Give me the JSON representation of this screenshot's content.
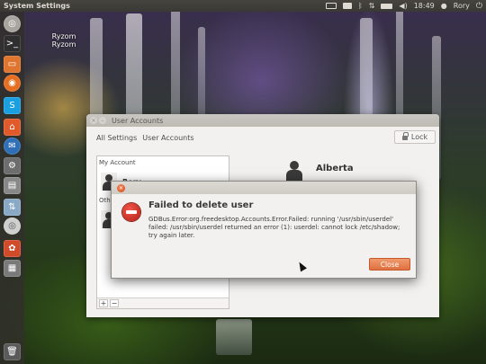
{
  "top_panel": {
    "app_title": "System Settings",
    "clock": "18:49",
    "user_name": "Rory"
  },
  "launcher": {
    "items": [
      {
        "name": "dash-icon",
        "color": "#a8a5a0"
      },
      {
        "name": "terminal-icon",
        "color": "#2f2f2f"
      },
      {
        "name": "files-icon",
        "color": "#e0752f"
      },
      {
        "name": "firefox-icon",
        "color": "#e66e21"
      },
      {
        "name": "skype-icon",
        "color": "#1a9fe0"
      },
      {
        "name": "software-center-icon",
        "color": "#e05a2b"
      },
      {
        "name": "thunderbird-icon",
        "color": "#2f6fb8"
      },
      {
        "name": "settings-icon",
        "color": "#6d6d6d"
      },
      {
        "name": "drive-icon",
        "color": "#888888"
      },
      {
        "name": "network-icon",
        "color": "#8aa9c6"
      },
      {
        "name": "dvd-icon",
        "color": "#cfcfcf"
      },
      {
        "name": "palette-icon",
        "color": "#d14a2a"
      },
      {
        "name": "system-monitor-icon",
        "color": "#7a7a7a"
      },
      {
        "name": "trash-icon",
        "color": "#5a5a5a"
      }
    ]
  },
  "desktop": {
    "label_line1": "Ryzom",
    "label_line2": "Ryzom"
  },
  "user_accounts": {
    "window_title": "User Accounts",
    "breadcrumb_all": "All Settings",
    "breadcrumb_current": "User Accounts",
    "lock_label": "Lock",
    "my_account_header": "My Account",
    "my_account_name": "Rory",
    "other_header": "Othe",
    "add_button": "+",
    "remove_button": "−",
    "selected_user_name": "Alberta"
  },
  "error_dialog": {
    "close_glyph": "×",
    "heading": "Failed to delete user",
    "message": "GDBus.Error:org.freedesktop.Accounts.Error.Failed: running '/usr/sbin/userdel' failed: /usr/sbin/userdel returned an error (1): userdel: cannot lock /etc/shadow; try again later.",
    "button_label": "Close"
  },
  "colors": {
    "accent": "#e0703f",
    "error_red": "#c42a1c",
    "panel": "#3f3e3a"
  }
}
